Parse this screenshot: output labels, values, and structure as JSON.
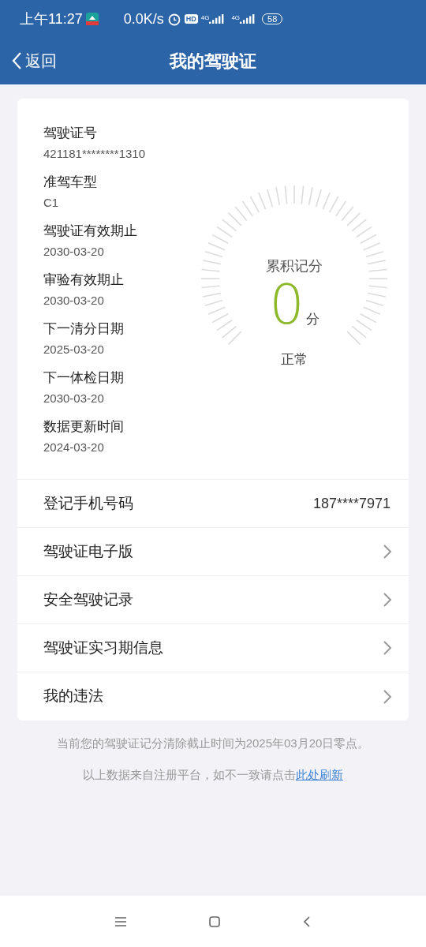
{
  "status_bar": {
    "time": "上午11:27",
    "speed": "0.0K/s",
    "hd": "HD",
    "network_1": "4G",
    "network_2": "4G",
    "battery": "58"
  },
  "header": {
    "back": "返回",
    "title": "我的驾驶证"
  },
  "details": [
    {
      "label": "驾驶证号",
      "value": "421181********1310"
    },
    {
      "label": "准驾车型",
      "value": "C1"
    },
    {
      "label": "驾驶证有效期止",
      "value": "2030-03-20"
    },
    {
      "label": "审验有效期止",
      "value": "2030-03-20"
    },
    {
      "label": "下一清分日期",
      "value": "2025-03-20"
    },
    {
      "label": "下一体检日期",
      "value": "2030-03-20"
    },
    {
      "label": "数据更新时间",
      "value": "2024-03-20"
    }
  ],
  "gauge": {
    "title": "累积记分",
    "score": "0",
    "unit": "分",
    "status": "正常"
  },
  "rows": [
    {
      "kind": "value",
      "label": "登记手机号码",
      "value": "187****7971"
    },
    {
      "kind": "link",
      "label": "驾驶证电子版"
    },
    {
      "kind": "link",
      "label": "安全驾驶记录"
    },
    {
      "kind": "link",
      "label": "驾驶证实习期信息"
    },
    {
      "kind": "link",
      "label": "我的违法"
    }
  ],
  "notice": "当前您的驾驶证记分清除截止时间为2025年03月20日零点。",
  "source_note": {
    "text": "以上数据来自注册平台，如不一致请点击",
    "link": "此处刷新"
  }
}
